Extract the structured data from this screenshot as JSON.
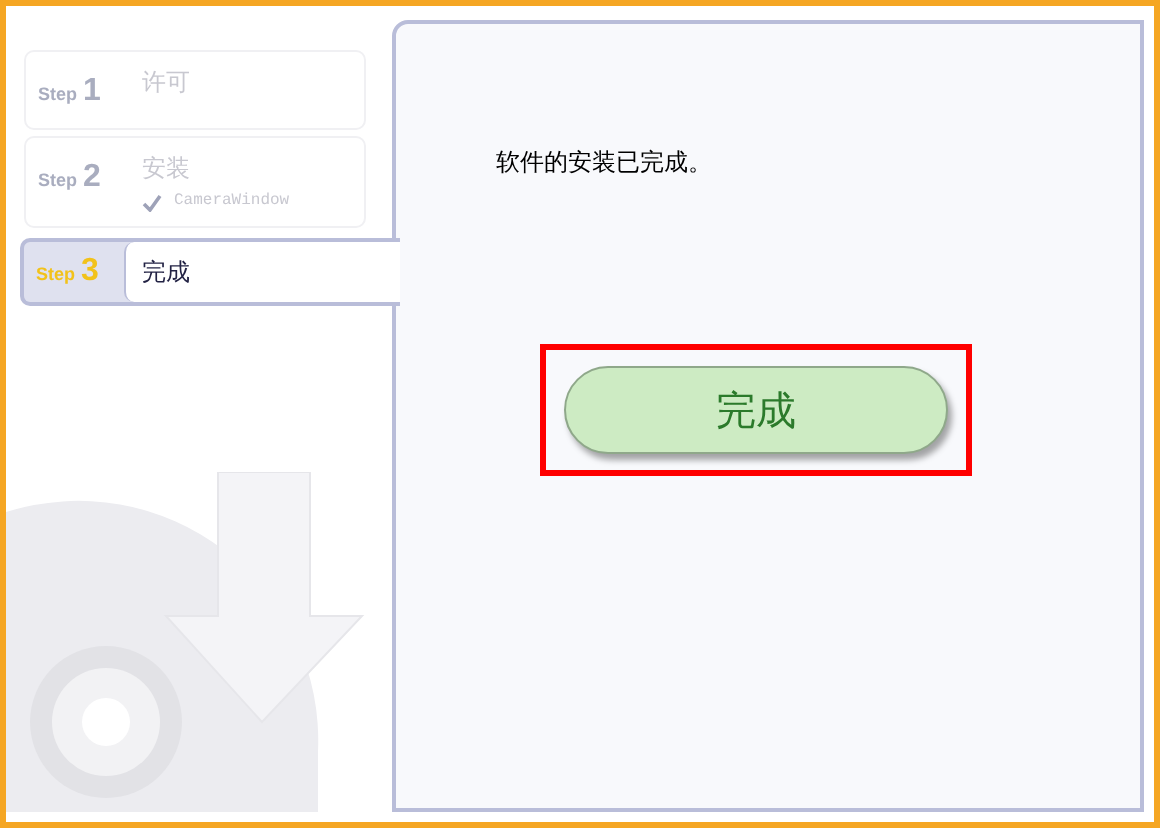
{
  "steps": [
    {
      "label": "Step",
      "number": "1",
      "title": "许可",
      "selected": false
    },
    {
      "label": "Step",
      "number": "2",
      "title": "安装",
      "selected": false,
      "items": [
        {
          "name": "CameraWindow",
          "checked": true
        }
      ]
    },
    {
      "label": "Step",
      "number": "3",
      "title": "完成",
      "selected": true
    }
  ],
  "message": "软件的安装已完成。",
  "finish_button": {
    "label": "完成",
    "highlighted": true
  }
}
